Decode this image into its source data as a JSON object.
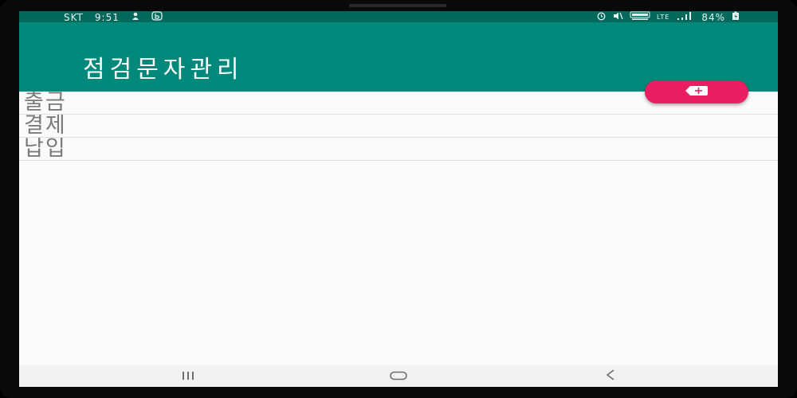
{
  "status_bar": {
    "carrier": "SKT",
    "time": "9:51",
    "network_label": "LTE",
    "battery": "84%",
    "icons": [
      "person-icon",
      "b-app-icon",
      "alarm-icon",
      "mute-icon",
      "volte-icon",
      "signal-icon",
      "battery-icon"
    ]
  },
  "app_bar": {
    "title": "점검문자관리",
    "color": "#00897b"
  },
  "fab": {
    "icon": "label-add-icon",
    "color": "#e91e63"
  },
  "list": {
    "items": [
      {
        "label": "출금"
      },
      {
        "label": "결제"
      },
      {
        "label": "납입"
      }
    ]
  },
  "nav_bar": {
    "buttons": [
      "recent-apps-icon",
      "home-icon",
      "back-icon"
    ]
  }
}
